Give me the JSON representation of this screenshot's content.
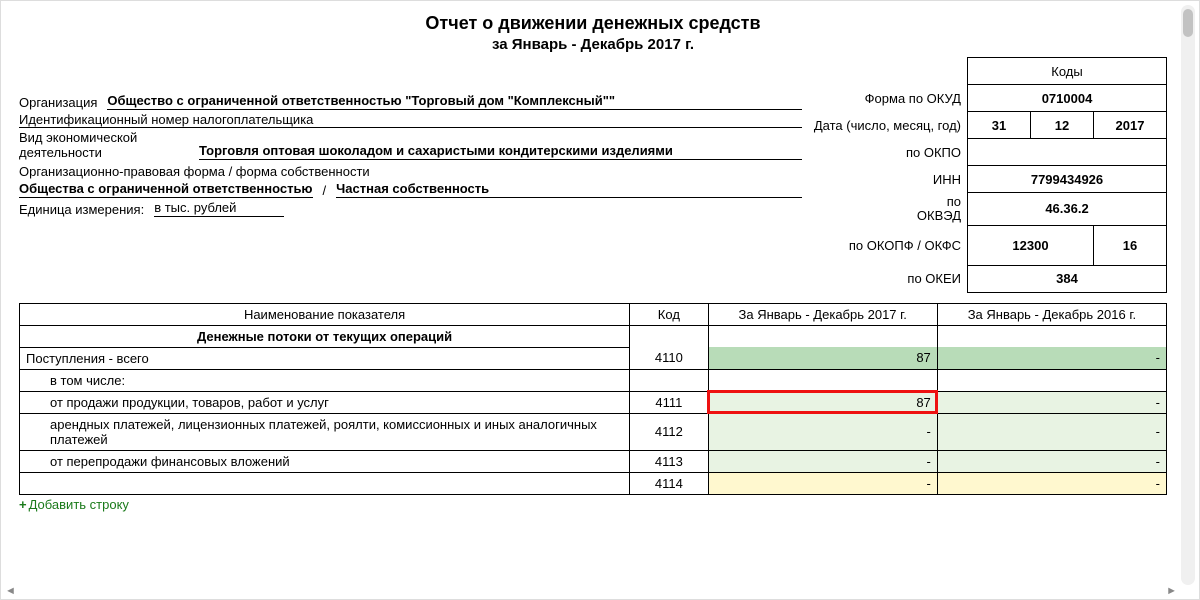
{
  "title": "Отчет о движении денежных средств",
  "subtitle": "за Январь - Декабрь 2017 г.",
  "codes": {
    "header": "Коды",
    "okud_label": "Форма по ОКУД",
    "okud": "0710004",
    "date_label": "Дата (число, месяц, год)",
    "date_d": "31",
    "date_m": "12",
    "date_y": "2017",
    "okpo_label": "по ОКПО",
    "okpo": "",
    "inn_label": "ИНН",
    "inn": "7799434926",
    "okved_label": "по ОКВЭД",
    "okved": "46.36.2",
    "okopf_label": "по ОКОПФ / ОКФС",
    "okopf": "12300",
    "okfs": "16",
    "okei_label": "по ОКЕИ",
    "okei": "384"
  },
  "org": {
    "label": "Организация",
    "value": "Общество с ограниченной ответственностью \"Торговый дом \"Комплексный\"\""
  },
  "inn_row": {
    "label": "Идентификационный номер налогоплательщика"
  },
  "activity": {
    "label": "Вид экономической деятельности",
    "value": "Торговля оптовая шоколадом и сахаристыми кондитерскими изделиями"
  },
  "legal": {
    "label": "Организационно-правовая форма / форма собственности",
    "value1": "Общества с ограниченной ответственностью",
    "sep": "/",
    "value2": "Частная собственность"
  },
  "unit": {
    "label": "Единица измерения:",
    "value": "в тыс. рублей"
  },
  "table": {
    "headers": {
      "name": "Наименование показателя",
      "code": "Код",
      "p1": "За Январь - Декабрь 2017 г.",
      "p2": "За Январь - Декабрь 2016 г."
    },
    "section": "Денежные потоки от текущих операций",
    "rows": [
      {
        "name": "Поступления - всего",
        "code": "4110",
        "v1": "87",
        "v2": "-",
        "bg": "dark",
        "indent": 0
      },
      {
        "name": "в том числе:",
        "code": "",
        "v1": "",
        "v2": "",
        "bg": "none",
        "indent": 1
      },
      {
        "name": "от продажи продукции, товаров, работ и услуг",
        "code": "4111",
        "v1": "87",
        "v2": "-",
        "bg": "lite",
        "indent": 1,
        "hl": true
      },
      {
        "name": "арендных платежей, лицензионных платежей, роялти, комиссионных и иных аналогичных платежей",
        "code": "4112",
        "v1": "-",
        "v2": "-",
        "bg": "lite",
        "indent": 1
      },
      {
        "name": "от перепродажи финансовых вложений",
        "code": "4113",
        "v1": "-",
        "v2": "-",
        "bg": "lite",
        "indent": 1
      },
      {
        "name": "",
        "code": "4114",
        "v1": "-",
        "v2": "-",
        "bg": "yellow",
        "indent": 1
      }
    ]
  },
  "add_row": "Добавить строку"
}
